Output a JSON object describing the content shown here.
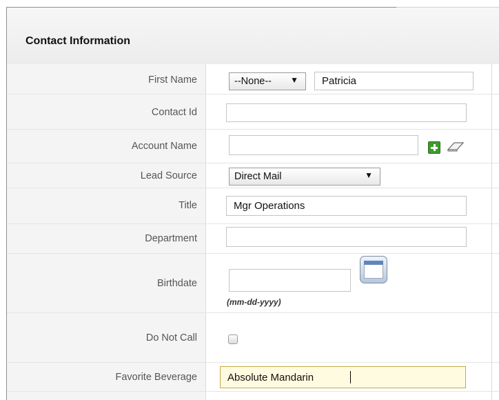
{
  "panel": {
    "title": "Contact Information"
  },
  "fields": {
    "first_name": {
      "label": "First Name",
      "salutation": "--None--",
      "value": "Patricia"
    },
    "contact_id": {
      "label": "Contact Id",
      "value": ""
    },
    "account_name": {
      "label": "Account Name",
      "value": "",
      "add_icon": "plus-icon",
      "clear_icon": "eraser-icon"
    },
    "lead_source": {
      "label": "Lead Source",
      "value": "Direct Mail"
    },
    "title": {
      "label": "Title",
      "value": "Mgr Operations"
    },
    "department": {
      "label": "Department",
      "value": ""
    },
    "birthdate": {
      "label": "Birthdate",
      "value": "",
      "hint": "(mm-dd-yyyy)",
      "icon": "calendar-icon"
    },
    "do_not_call": {
      "label": "Do Not Call",
      "checked": false
    },
    "favorite_beverage": {
      "label": "Favorite Beverage",
      "value": "Absolute Mandarin"
    }
  },
  "colors": {
    "label_bg": "#f4f4f4",
    "focus_bg": "#fffbe0",
    "add_green": "#3e9a2c"
  }
}
